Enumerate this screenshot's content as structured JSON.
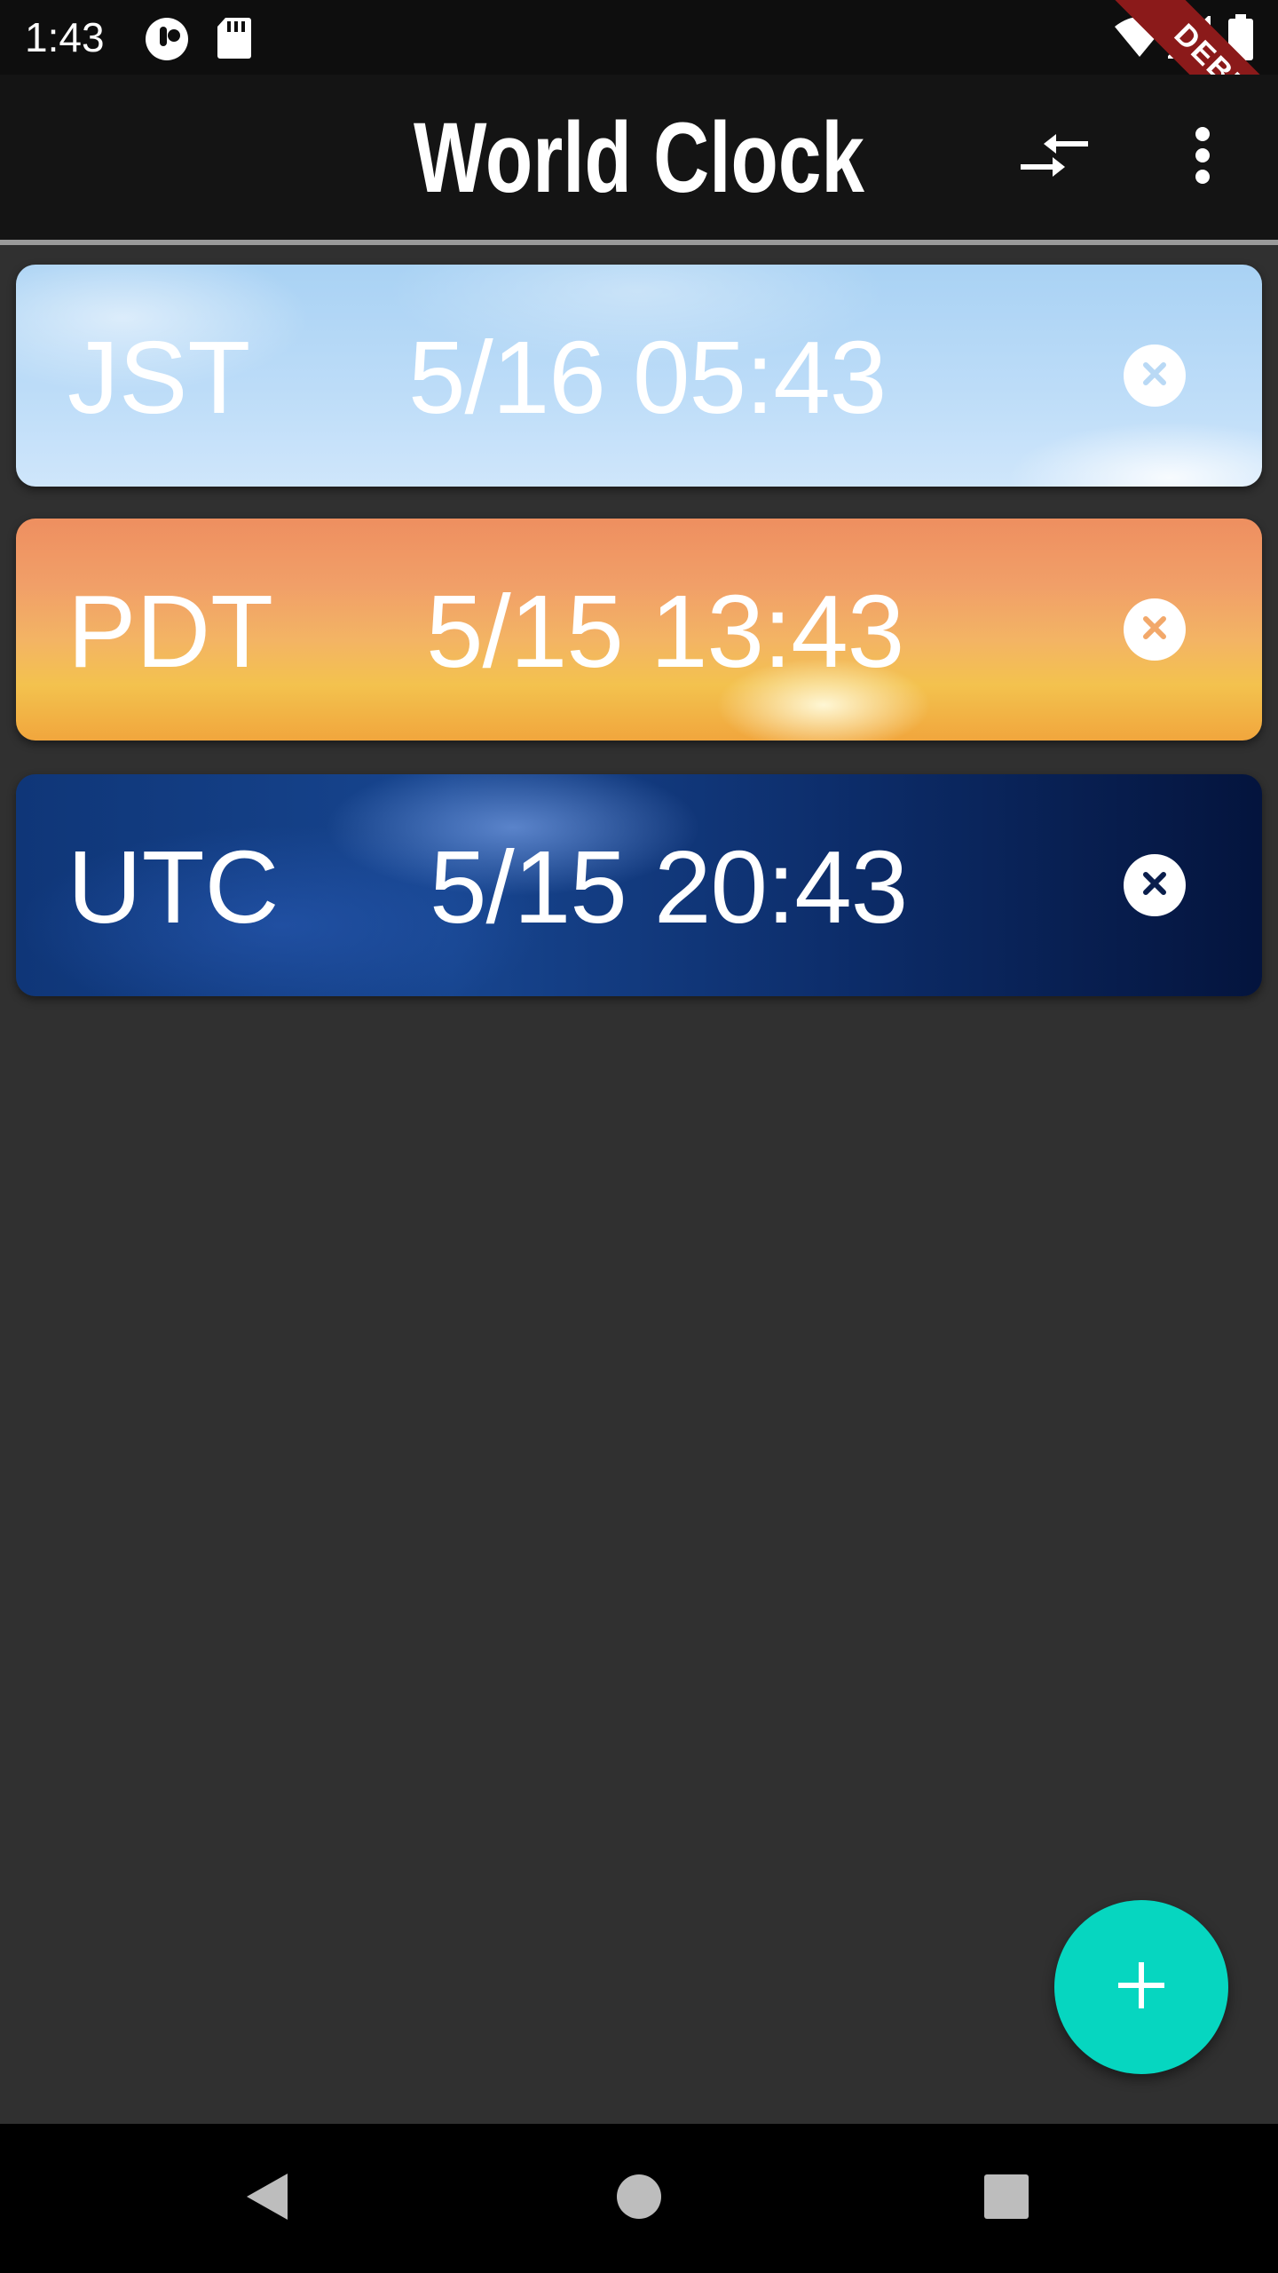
{
  "status_bar": {
    "time": "1:43",
    "debug_label": "DEBUG",
    "icons": [
      "notification-app-icon",
      "sd-card-icon",
      "wifi-icon",
      "cell-signal-icon",
      "battery-icon"
    ]
  },
  "app_bar": {
    "title": "World Clock",
    "actions": [
      "compare-arrows-icon",
      "more-vert-icon"
    ]
  },
  "clocks": [
    {
      "zone": "JST",
      "datetime": "5/16 05:43",
      "theme": "day-sky"
    },
    {
      "zone": "PDT",
      "datetime": "5/15 13:43",
      "theme": "sunset"
    },
    {
      "zone": "UTC",
      "datetime": "5/15 20:43",
      "theme": "night"
    }
  ],
  "fab": {
    "icon": "plus-icon",
    "color": "#06d6c0"
  },
  "nav_bar": {
    "buttons": [
      "back-icon",
      "home-icon",
      "recents-icon"
    ]
  },
  "colors": {
    "background": "#303030",
    "app_bar": "#141414",
    "fab": "#06d6c0",
    "debug_ribbon": "#8b1a1a"
  }
}
